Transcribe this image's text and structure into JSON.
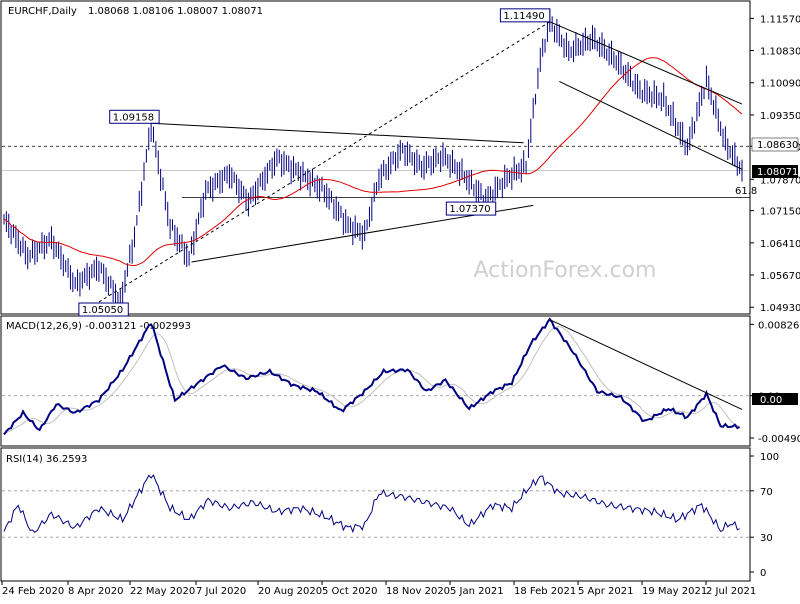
{
  "chart_data": {
    "type": "line",
    "title": "EURCHF,Daily",
    "ohlc": "1.08068 1.08106 1.08007 1.08071",
    "watermark": "ActionForex.com",
    "x_tick_labels": [
      "24 Feb 2020",
      "8 Apr 2020",
      "22 May 2020",
      "7 Jul 2020",
      "20 Aug 2020",
      "5 Oct 2020",
      "18 Nov 2020",
      "5 Jan 2021",
      "18 Feb 2021",
      "5 Apr 2021",
      "19 May 2021",
      "2 Jul 2021"
    ],
    "price_panel": {
      "ylim": [
        1.0482,
        1.119
      ],
      "y_ticks": [
        "1.11570",
        "1.10830",
        "1.10090",
        "1.09350",
        "1.08630",
        "1.07870",
        "1.07150",
        "1.06410",
        "1.05670",
        "1.04930"
      ],
      "last_price": "1.08071",
      "level_line": "1.08630",
      "fib_label": "61.8",
      "fib_value": 1.0745,
      "pivot_labels": [
        {
          "text": "1.09158",
          "i": 62,
          "v": 1.09158
        },
        {
          "text": "1.05050",
          "i": 49,
          "v": 1.0505
        },
        {
          "text": "1.07370",
          "i": 203,
          "v": 1.0737
        },
        {
          "text": "1.11490",
          "i": 230,
          "v": 1.1149
        }
      ],
      "series": [
        {
          "name": "close",
          "color": "#000080"
        },
        {
          "name": "sma",
          "color": "#e00000"
        }
      ],
      "anchors": [
        [
          0,
          1.0695
        ],
        [
          10,
          1.061
        ],
        [
          20,
          1.0648
        ],
        [
          30,
          1.0545
        ],
        [
          40,
          1.0585
        ],
        [
          49,
          1.0505
        ],
        [
          55,
          1.0655
        ],
        [
          62,
          1.0912
        ],
        [
          70,
          1.068
        ],
        [
          78,
          1.0605
        ],
        [
          85,
          1.076
        ],
        [
          95,
          1.08
        ],
        [
          103,
          1.0735
        ],
        [
          115,
          1.0835
        ],
        [
          125,
          1.08
        ],
        [
          135,
          1.076
        ],
        [
          145,
          1.068
        ],
        [
          152,
          1.066
        ],
        [
          158,
          1.079
        ],
        [
          168,
          1.0855
        ],
        [
          176,
          1.0815
        ],
        [
          185,
          1.084
        ],
        [
          194,
          1.0795
        ],
        [
          203,
          1.0737
        ],
        [
          212,
          1.079
        ],
        [
          220,
          1.082
        ],
        [
          226,
          1.106
        ],
        [
          230,
          1.1149
        ],
        [
          238,
          1.108
        ],
        [
          248,
          1.111
        ],
        [
          258,
          1.106
        ],
        [
          268,
          1.099
        ],
        [
          278,
          1.097
        ],
        [
          288,
          1.086
        ],
        [
          296,
          1.1015
        ],
        [
          304,
          1.087
        ],
        [
          311,
          1.0807
        ]
      ]
    },
    "macd_panel": {
      "label": "MACD(12,26,9) -0.003121 -0.002993",
      "ylim": [
        -0.0056,
        0.009
      ],
      "y_ticks": [
        "0.008263",
        "0.00",
        "-0.004904"
      ],
      "last_value": "0.00",
      "series": [
        {
          "name": "macd",
          "color": "#000080"
        },
        {
          "name": "signal",
          "color": "#c0c0c0"
        }
      ],
      "anchors": [
        [
          0,
          -0.0045
        ],
        [
          8,
          -0.002
        ],
        [
          15,
          -0.004
        ],
        [
          22,
          -0.001
        ],
        [
          30,
          -0.002
        ],
        [
          40,
          -0.0005
        ],
        [
          50,
          0.003
        ],
        [
          62,
          0.0085
        ],
        [
          72,
          -0.0005
        ],
        [
          82,
          0.0015
        ],
        [
          92,
          0.0035
        ],
        [
          102,
          0.002
        ],
        [
          112,
          0.0028
        ],
        [
          122,
          0.0012
        ],
        [
          132,
          0.0005
        ],
        [
          142,
          -0.0018
        ],
        [
          152,
          0.0005
        ],
        [
          160,
          0.0028
        ],
        [
          170,
          0.003
        ],
        [
          178,
          0.0005
        ],
        [
          186,
          0.0018
        ],
        [
          196,
          -0.0015
        ],
        [
          206,
          0.0005
        ],
        [
          214,
          0.0015
        ],
        [
          222,
          0.006
        ],
        [
          230,
          0.0088
        ],
        [
          240,
          0.005
        ],
        [
          250,
          0.0005
        ],
        [
          260,
          -0.0002
        ],
        [
          270,
          -0.003
        ],
        [
          280,
          -0.0015
        ],
        [
          288,
          -0.0025
        ],
        [
          296,
          0.0002
        ],
        [
          302,
          -0.0035
        ],
        [
          310,
          -0.0036
        ]
      ]
    },
    "rsi_panel": {
      "label": "RSI(14) 36.2593",
      "ylim": [
        0,
        100
      ],
      "y_ticks": [
        "100",
        "70",
        "30",
        "0"
      ],
      "levels": [
        70,
        30
      ],
      "series": [
        {
          "name": "rsi",
          "color": "#000080"
        }
      ],
      "anchors": [
        [
          0,
          35
        ],
        [
          6,
          58
        ],
        [
          12,
          33
        ],
        [
          20,
          50
        ],
        [
          30,
          38
        ],
        [
          40,
          55
        ],
        [
          50,
          45
        ],
        [
          58,
          72
        ],
        [
          62,
          85
        ],
        [
          70,
          55
        ],
        [
          78,
          45
        ],
        [
          86,
          62
        ],
        [
          95,
          55
        ],
        [
          105,
          60
        ],
        [
          115,
          52
        ],
        [
          125,
          55
        ],
        [
          135,
          48
        ],
        [
          145,
          38
        ],
        [
          152,
          40
        ],
        [
          158,
          68
        ],
        [
          168,
          65
        ],
        [
          178,
          60
        ],
        [
          188,
          55
        ],
        [
          196,
          40
        ],
        [
          206,
          58
        ],
        [
          214,
          55
        ],
        [
          220,
          70
        ],
        [
          226,
          82
        ],
        [
          234,
          68
        ],
        [
          244,
          65
        ],
        [
          254,
          58
        ],
        [
          264,
          55
        ],
        [
          274,
          52
        ],
        [
          284,
          45
        ],
        [
          294,
          58
        ],
        [
          302,
          36
        ],
        [
          306,
          42
        ],
        [
          310,
          38
        ]
      ]
    },
    "trendlines": [
      {
        "style": "solid",
        "points": [
          [
            62,
            1.09158
          ],
          [
            219,
            1.0871
          ]
        ]
      },
      {
        "style": "solid",
        "points": [
          [
            79,
            1.0597
          ],
          [
            223,
            1.0727
          ]
        ]
      },
      {
        "style": "dashed",
        "points": [
          [
            40,
            1.0505
          ],
          [
            230,
            1.1149
          ]
        ]
      },
      {
        "style": "solid",
        "points": [
          [
            230,
            1.1149
          ],
          [
            311,
            1.096
          ]
        ]
      },
      {
        "style": "solid",
        "points": [
          [
            234,
            1.1012
          ],
          [
            311,
            1.081
          ]
        ]
      }
    ],
    "macd_trendline": {
      "points": [
        [
          230,
          0.0088
        ],
        [
          311,
          -0.0016
        ]
      ]
    }
  }
}
